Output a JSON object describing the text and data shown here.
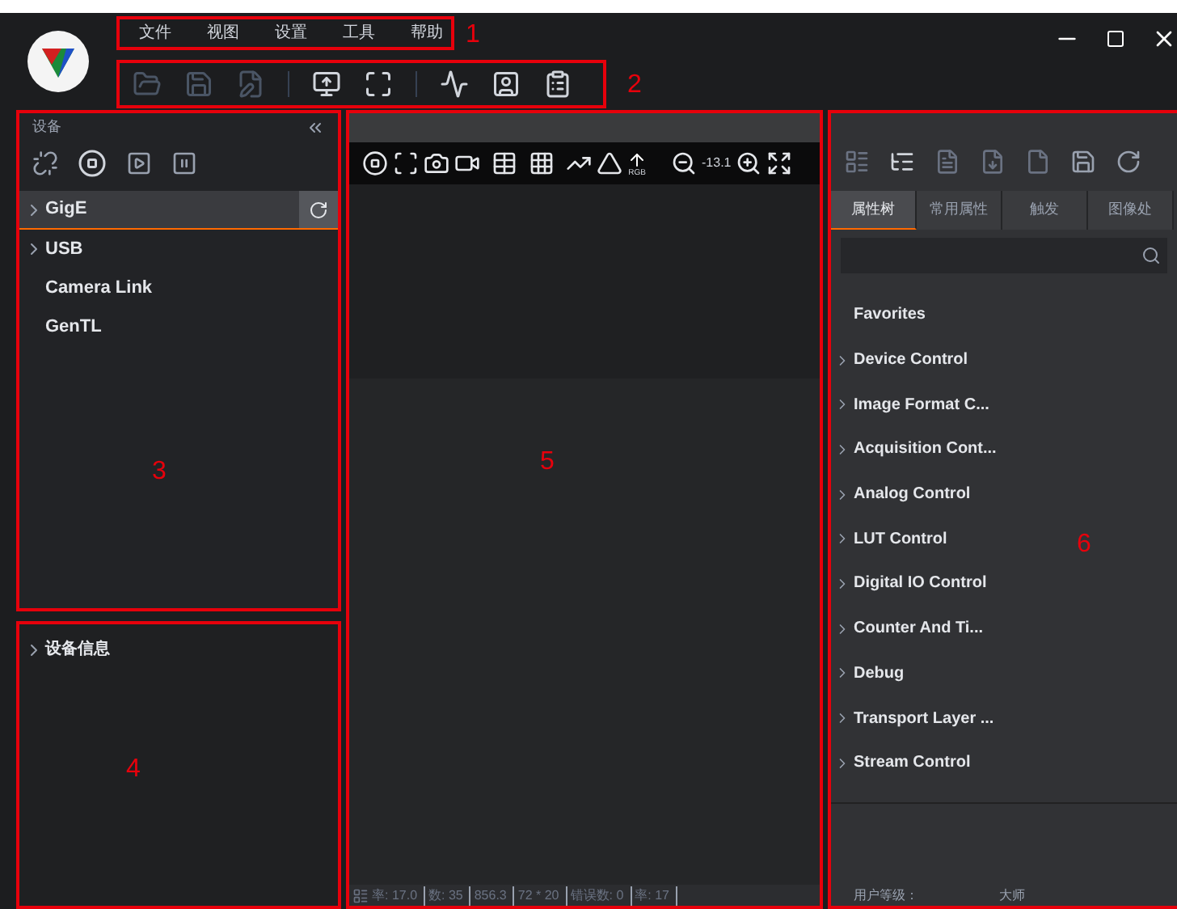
{
  "menu": [
    "文件",
    "视图",
    "设置",
    "工具",
    "帮助"
  ],
  "annotations": [
    "1",
    "2",
    "3",
    "4",
    "5",
    "6"
  ],
  "devices_panel": {
    "title": "设备",
    "items": [
      {
        "label": "GigE",
        "has_children": true,
        "selected": true
      },
      {
        "label": "USB",
        "has_children": true,
        "selected": false
      },
      {
        "label": "Camera Link",
        "has_children": false,
        "selected": false
      },
      {
        "label": "GenTL",
        "has_children": false,
        "selected": false
      }
    ]
  },
  "info_panel": {
    "items": [
      {
        "label": "设备信息",
        "has_children": true
      }
    ]
  },
  "viewer": {
    "badge": "RGB",
    "zoom": "-13.1",
    "status": [
      "率: 17.0",
      "数: 35",
      "856.3",
      "72 * 20",
      "错误数: 0",
      "率: 17"
    ]
  },
  "properties": {
    "tabs": [
      {
        "label": "属性树",
        "selected": true
      },
      {
        "label": "常用属性",
        "selected": false
      },
      {
        "label": "触发",
        "selected": false
      },
      {
        "label": "图像处",
        "selected": false
      }
    ],
    "items": [
      {
        "label": "Favorites",
        "has_children": false
      },
      {
        "label": "Device Control",
        "has_children": true
      },
      {
        "label": "Image Format C...",
        "has_children": true
      },
      {
        "label": "Acquisition Cont...",
        "has_children": true
      },
      {
        "label": "Analog Control",
        "has_children": true
      },
      {
        "label": "LUT Control",
        "has_children": true
      },
      {
        "label": "Digital IO Control",
        "has_children": true
      },
      {
        "label": "Counter And Ti...",
        "has_children": true
      },
      {
        "label": "Debug",
        "has_children": true
      },
      {
        "label": "Transport Layer ...",
        "has_children": true
      },
      {
        "label": "Stream Control",
        "has_children": true
      }
    ],
    "user_level_label": "用户等级：",
    "user_level": "大师"
  }
}
